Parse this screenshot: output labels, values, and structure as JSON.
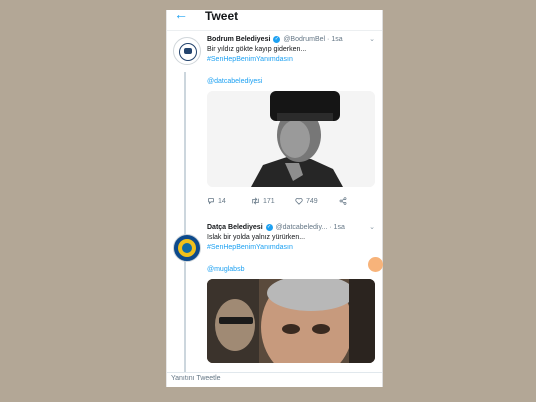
{
  "colors": {
    "accent": "#1da1f2",
    "backdrop": "#b3a796",
    "text": "#14171a",
    "muted": "#657786"
  },
  "header": {
    "back_icon": "arrow-left-icon",
    "title": "Tweet"
  },
  "tweets": [
    {
      "name": "Bodrum Belediyesi",
      "handle": "@BodrumBel",
      "time": "1sa",
      "text": "Bir yıldız gökte kayıp giderken...",
      "hashtag": "#SenHepBenimYanımdasın",
      "mention": "@datcabelediyesi",
      "stats": {
        "replies": "14",
        "retweets": "171",
        "likes": "749"
      }
    },
    {
      "name": "Datça Belediyesi",
      "handle": "@datcabelediy...",
      "time": "1sa",
      "text": "Islak bir yolda yalnız yürürken...",
      "hashtag": "#SenHepBenimYanımdasın",
      "mention": "@muglabsb"
    }
  ],
  "reply_bar": {
    "placeholder": "Yanıtını Tweetle"
  }
}
